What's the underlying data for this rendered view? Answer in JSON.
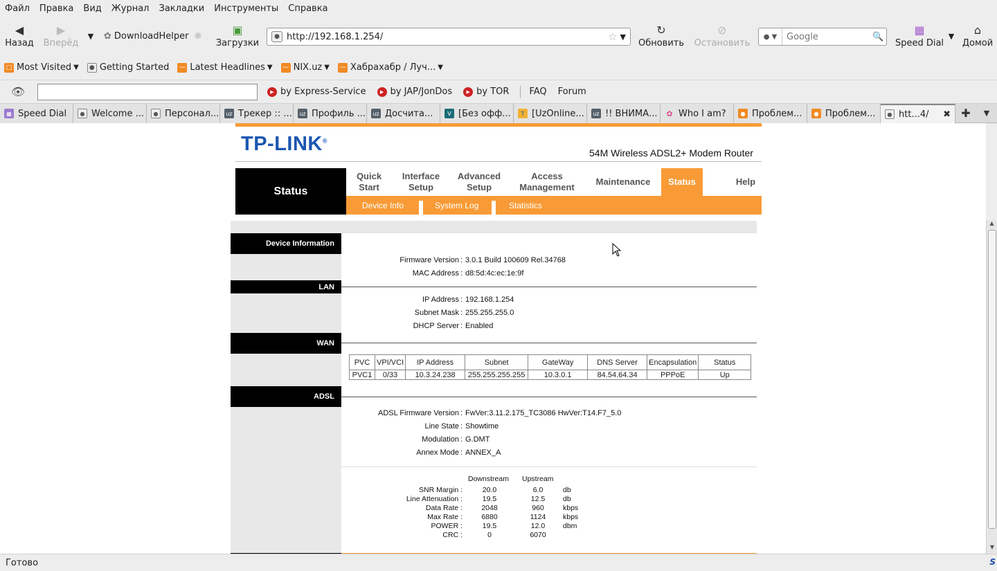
{
  "browser": {
    "menu": [
      "Файл",
      "Правка",
      "Вид",
      "Журнал",
      "Закладки",
      "Инструменты",
      "Справка"
    ],
    "nav": {
      "back": "Назад",
      "forward": "Вперёд",
      "downloadhelper": "DownloadHelper",
      "downloads": "Загрузки",
      "url": "http://192.168.1.254/",
      "reload": "Обновить",
      "stop": "Остановить",
      "search_placeholder": "Google",
      "speed_dial": "Speed Dial",
      "home": "Домой"
    },
    "bookmarks": [
      "Most Visited",
      "Getting Started",
      "Latest Headlines",
      "NIX.uz",
      "Хабрахабр / Луч..."
    ],
    "jondo": [
      "by Express-Service",
      "by JAP/JonDos",
      "by TOR",
      "FAQ",
      "Forum"
    ],
    "tabs": [
      "Speed Dial",
      "Welcome ...",
      "Персонал...",
      "Трекер :: ...",
      "Профиль ...",
      "Досчита...",
      "[Без офф...",
      "[UzOnline...",
      "!! ВНИМА...",
      "Who I am?",
      "Проблем...",
      "Проблем...",
      "htt...4/"
    ],
    "status": "Готово"
  },
  "router": {
    "logo": "TP-LINK",
    "model": "54M Wireless ADSL2+ Modem Router",
    "section_title": "Status",
    "nav": {
      "quick_start": "Quick Start",
      "interface_setup": "Interface Setup",
      "advanced_setup": "Advanced Setup",
      "access_management": "Access Management",
      "maintenance": "Maintenance",
      "status": "Status",
      "help": "Help"
    },
    "subnav": [
      "Device Info",
      "System Log",
      "Statistics"
    ],
    "sections": {
      "device_info": "Device Information",
      "lan": "LAN",
      "wan": "WAN",
      "adsl": "ADSL"
    },
    "device": {
      "fw_label": "Firmware Version",
      "fw": "3.0.1 Build 100609 Rel.34768",
      "mac_label": "MAC Address",
      "mac": "d8:5d:4c:ec:1e:9f"
    },
    "lan": {
      "ip_label": "IP Address",
      "ip": "192.168.1.254",
      "mask_label": "Subnet Mask",
      "mask": "255.255.255.0",
      "dhcp_label": "DHCP Server",
      "dhcp": "Enabled"
    },
    "wan": {
      "headers": [
        "PVC",
        "VPI/VCI",
        "IP Address",
        "Subnet",
        "GateWay",
        "DNS Server",
        "Encapsulation",
        "Status"
      ],
      "rows": [
        [
          "PVC1",
          "0/33",
          "10.3.24.238",
          "255.255.255.255",
          "10.3.0.1",
          "84.54.64.34",
          "PPPoE",
          "Up"
        ]
      ]
    },
    "adsl": {
      "fw_label": "ADSL Firmware Version",
      "fw": "FwVer:3.11.2.175_TC3086 HwVer:T14.F7_5.0",
      "line_label": "Line State",
      "line": "Showtime",
      "mod_label": "Modulation",
      "mod": "G.DMT",
      "annex_label": "Annex Mode",
      "annex": "ANNEX_A"
    },
    "stats": {
      "col_down": "Downstream",
      "col_up": "Upstream",
      "rows": [
        {
          "label": "SNR Margin :",
          "down": "20.0",
          "up": "6.0",
          "unit": "db"
        },
        {
          "label": "Line Attenuation :",
          "down": "19.5",
          "up": "12.5",
          "unit": "db"
        },
        {
          "label": "Data Rate :",
          "down": "2048",
          "up": "960",
          "unit": "kbps"
        },
        {
          "label": "Max Rate :",
          "down": "6880",
          "up": "1124",
          "unit": "kbps"
        },
        {
          "label": "POWER :",
          "down": "19.5",
          "up": "12.0",
          "unit": "dbm"
        },
        {
          "label": "CRC :",
          "down": "0",
          "up": "6070",
          "unit": ""
        }
      ]
    }
  }
}
